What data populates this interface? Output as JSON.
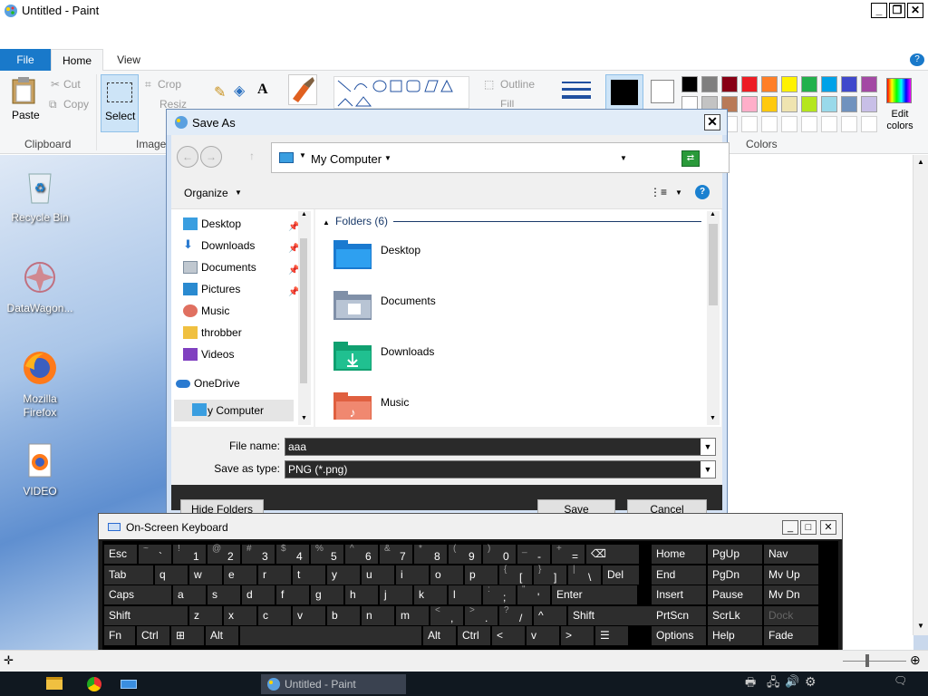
{
  "paint": {
    "title": "Untitled - Paint",
    "tabs": {
      "file": "File",
      "home": "Home",
      "view": "View"
    },
    "clipboard": {
      "paste": "Paste",
      "cut": "Cut",
      "copy": "Copy",
      "group": "Clipboard"
    },
    "image": {
      "select": "Select",
      "crop": "Crop",
      "resize": "Resize",
      "group": "Image"
    },
    "shapes": {
      "outline": "Outline",
      "fill": "Fill"
    },
    "colors": {
      "group": "Colors",
      "edit": "Edit colors"
    },
    "palette_row1": [
      "#000000",
      "#7f7f7f",
      "#880015",
      "#ed1c24",
      "#ff7f27",
      "#fff200",
      "#22b14c",
      "#00a2e8",
      "#3f48cc",
      "#a349a4"
    ],
    "palette_row2": [
      "#ffffff",
      "#c3c3c3",
      "#b97a57",
      "#ffaec9",
      "#ffc90e",
      "#efe4b0",
      "#b5e61d",
      "#99d9ea",
      "#7092be",
      "#c8bfe7"
    ]
  },
  "desktop": {
    "icons": [
      {
        "label": "Recycle Bin",
        "icon": "recycle-bin-icon"
      },
      {
        "label": "DataWagon...",
        "icon": "datawagon-icon"
      },
      {
        "label": "Mozilla Firefox",
        "icon": "firefox-icon"
      },
      {
        "label": "VIDEO",
        "icon": "video-file-icon"
      }
    ]
  },
  "saveas": {
    "title": "Save As",
    "address": "My Computer",
    "organize": "Organize",
    "nav_items": [
      {
        "label": "Desktop",
        "icon": "desktop-icon",
        "pinned": true
      },
      {
        "label": "Downloads",
        "icon": "download-icon",
        "pinned": true
      },
      {
        "label": "Documents",
        "icon": "documents-icon",
        "pinned": true
      },
      {
        "label": "Pictures",
        "icon": "pictures-icon",
        "pinned": true
      },
      {
        "label": "Music",
        "icon": "music-icon",
        "pinned": false
      },
      {
        "label": "throbber",
        "icon": "folder-icon",
        "pinned": false
      },
      {
        "label": "Videos",
        "icon": "videos-icon",
        "pinned": false
      },
      {
        "label": "OneDrive",
        "icon": "cloud-icon",
        "pinned": false
      },
      {
        "label": "My Computer",
        "icon": "computer-icon",
        "pinned": false
      }
    ],
    "folders_header": "Folders (6)",
    "folders": [
      "Desktop",
      "Documents",
      "Downloads",
      "Music"
    ],
    "file_name_label": "File name:",
    "file_name_value": "aaa",
    "save_type_label": "Save as type:",
    "save_type_value": "PNG (*.png)",
    "hide_folders": "Hide Folders",
    "save": "Save",
    "cancel": "Cancel"
  },
  "osk": {
    "title": "On-Screen Keyboard",
    "row1": [
      {
        "m": "Esc"
      },
      {
        "s": "~",
        "b": "`"
      },
      {
        "s": "!",
        "b": "1"
      },
      {
        "s": "@",
        "b": "2"
      },
      {
        "s": "#",
        "b": "3"
      },
      {
        "s": "$",
        "b": "4"
      },
      {
        "s": "%",
        "b": "5"
      },
      {
        "s": "^",
        "b": "6"
      },
      {
        "s": "&",
        "b": "7"
      },
      {
        "s": "*",
        "b": "8"
      },
      {
        "s": "(",
        "b": "9"
      },
      {
        "s": ")",
        "b": "0"
      },
      {
        "s": "_",
        "b": "-"
      },
      {
        "s": "+",
        "b": "="
      },
      {
        "m": "⌫"
      },
      {
        "m": "Home"
      },
      {
        "m": "PgUp"
      },
      {
        "m": "Nav"
      }
    ],
    "row2": [
      {
        "m": "Tab"
      },
      {
        "m": "q"
      },
      {
        "m": "w"
      },
      {
        "m": "e"
      },
      {
        "m": "r"
      },
      {
        "m": "t"
      },
      {
        "m": "y"
      },
      {
        "m": "u"
      },
      {
        "m": "i"
      },
      {
        "m": "o"
      },
      {
        "m": "p"
      },
      {
        "s": "{",
        "b": "["
      },
      {
        "s": "}",
        "b": "]"
      },
      {
        "s": "|",
        "b": "\\"
      },
      {
        "m": "Del"
      },
      {
        "m": "End"
      },
      {
        "m": "PgDn"
      },
      {
        "m": "Mv Up"
      }
    ],
    "row3": [
      {
        "m": "Caps"
      },
      {
        "m": "a"
      },
      {
        "m": "s"
      },
      {
        "m": "d"
      },
      {
        "m": "f"
      },
      {
        "m": "g"
      },
      {
        "m": "h"
      },
      {
        "m": "j"
      },
      {
        "m": "k"
      },
      {
        "m": "l"
      },
      {
        "s": ":",
        "b": ";"
      },
      {
        "s": "\"",
        "b": "'"
      },
      {
        "m": "Enter"
      },
      {
        "m": "Insert"
      },
      {
        "m": "Pause"
      },
      {
        "m": "Mv Dn"
      }
    ],
    "row4": [
      {
        "m": "Shift"
      },
      {
        "m": "z"
      },
      {
        "m": "x"
      },
      {
        "m": "c"
      },
      {
        "m": "v"
      },
      {
        "m": "b"
      },
      {
        "m": "n"
      },
      {
        "m": "m"
      },
      {
        "s": "<",
        "b": ","
      },
      {
        "s": ">",
        "b": "."
      },
      {
        "s": "?",
        "b": "/"
      },
      {
        "m": "^"
      },
      {
        "m": "Shift"
      },
      {
        "m": "PrtScn"
      },
      {
        "m": "ScrLk"
      },
      {
        "m": "Dock"
      }
    ],
    "row5": [
      {
        "m": "Fn"
      },
      {
        "m": "Ctrl"
      },
      {
        "m": "⊞"
      },
      {
        "m": "Alt"
      },
      {
        "m": ""
      },
      {
        "m": "Alt"
      },
      {
        "m": "Ctrl"
      },
      {
        "m": "<"
      },
      {
        "m": "v"
      },
      {
        "m": ">"
      },
      {
        "m": "☰"
      },
      {
        "m": "Options"
      },
      {
        "m": "Help"
      },
      {
        "m": "Fade"
      }
    ]
  },
  "taskbar": {
    "active_window": "Untitled - Paint"
  }
}
